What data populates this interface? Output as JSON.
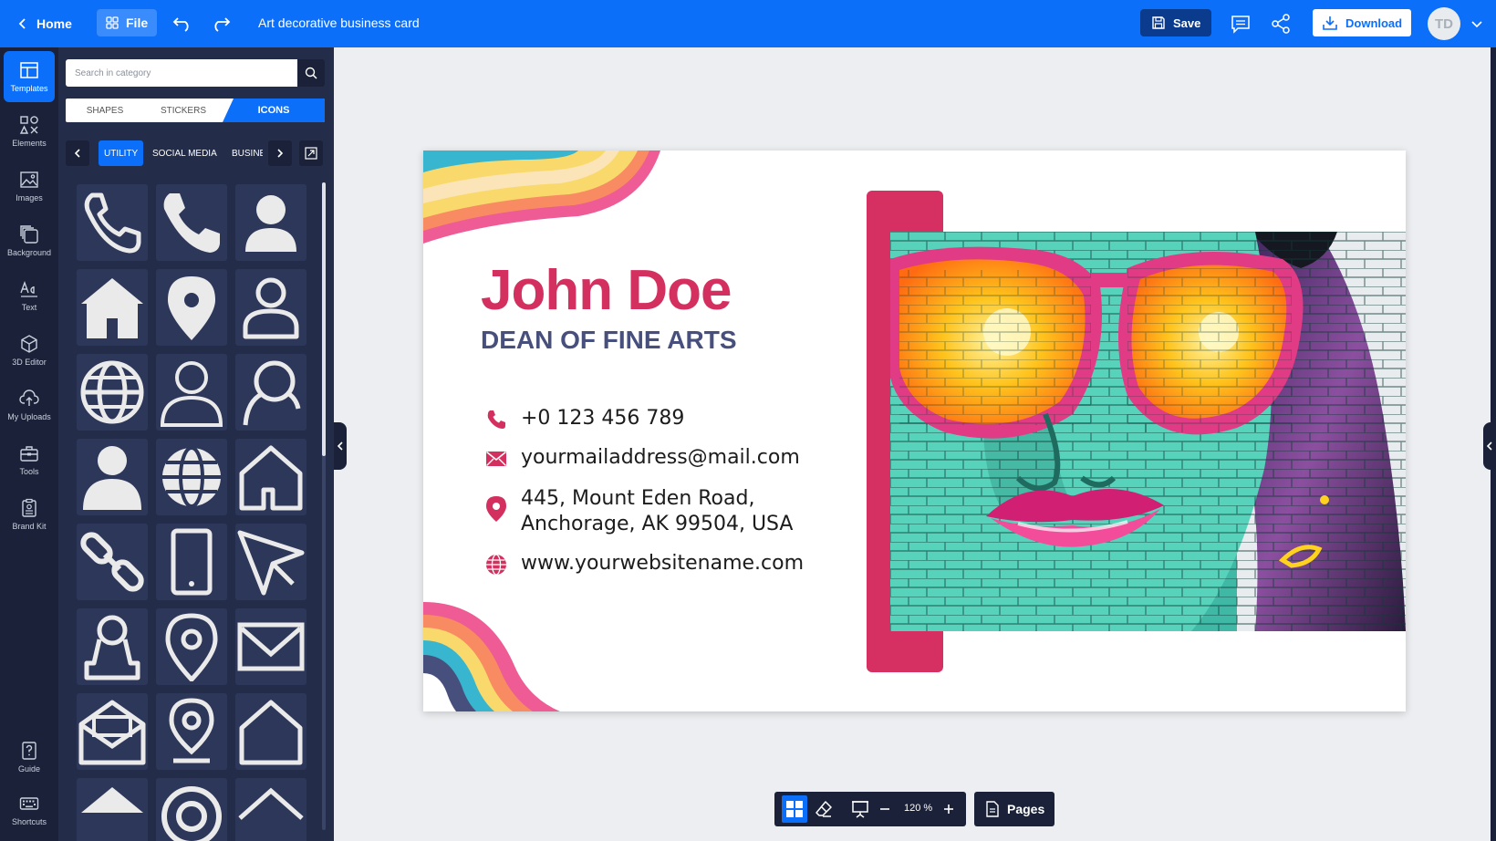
{
  "header": {
    "home_label": "Home",
    "file_label": "File",
    "doc_title": "Art decorative business card",
    "save_label": "Save",
    "download_label": "Download",
    "avatar_initials": "TD"
  },
  "rail": {
    "items": [
      {
        "label": "Templates",
        "icon": "template-icon"
      },
      {
        "label": "Elements",
        "icon": "elements-icon"
      },
      {
        "label": "Images",
        "icon": "image-icon"
      },
      {
        "label": "Background",
        "icon": "background-icon"
      },
      {
        "label": "Text",
        "icon": "text-icon"
      },
      {
        "label": "3D Editor",
        "icon": "cube-icon"
      },
      {
        "label": "My Uploads",
        "icon": "upload-icon"
      },
      {
        "label": "Tools",
        "icon": "toolbox-icon"
      },
      {
        "label": "Brand Kit",
        "icon": "brand-kit-icon"
      },
      {
        "label": "Guide",
        "icon": "guide-icon"
      },
      {
        "label": "Shortcuts",
        "icon": "keyboard-icon"
      }
    ],
    "active": "Templates"
  },
  "panel": {
    "search_placeholder": "Search in category",
    "tabs": [
      "SHAPES",
      "STICKERS",
      "ICONS"
    ],
    "active_tab": "ICONS",
    "categories": [
      "UTILITY",
      "SOCIAL MEDIA",
      "BUSINESS"
    ],
    "active_category": "UTILITY",
    "icons": [
      "phone-outline-icon",
      "phone-solid-icon",
      "user-solid-icon",
      "home-solid-icon",
      "location-pin-solid-icon",
      "user-outline-icon",
      "globe-outline-icon",
      "user-thin-icon",
      "user-search-icon",
      "user-bold-icon",
      "globe-solid-icon",
      "home-outline-icon",
      "link-icon",
      "mobile-icon",
      "send-icon",
      "user-bust-icon",
      "location-pin-outline-icon",
      "mail-outline-icon",
      "mail-open-icon",
      "location-marker-icon",
      "home-thin-icon",
      "home-roof-icon",
      "target-icon",
      "roof-outline-icon"
    ]
  },
  "card": {
    "name": "John Doe",
    "title": "DEAN OF FINE ARTS",
    "phone": "+0 123 456 789",
    "email": "yourmailaddress@mail.com",
    "address_line1": "445, Mount Eden Road,",
    "address_line2": "Anchorage, AK 99504, USA",
    "website": "www.yourwebsitename.com",
    "accent_color": "#d4305f",
    "title_color": "#474f7d"
  },
  "bottom_toolbar": {
    "zoom": "120 %",
    "pages_label": "Pages"
  },
  "colors": {
    "primary": "#0c6ff9",
    "dark_bg": "#1a2138",
    "panel_bg": "#232c49"
  }
}
